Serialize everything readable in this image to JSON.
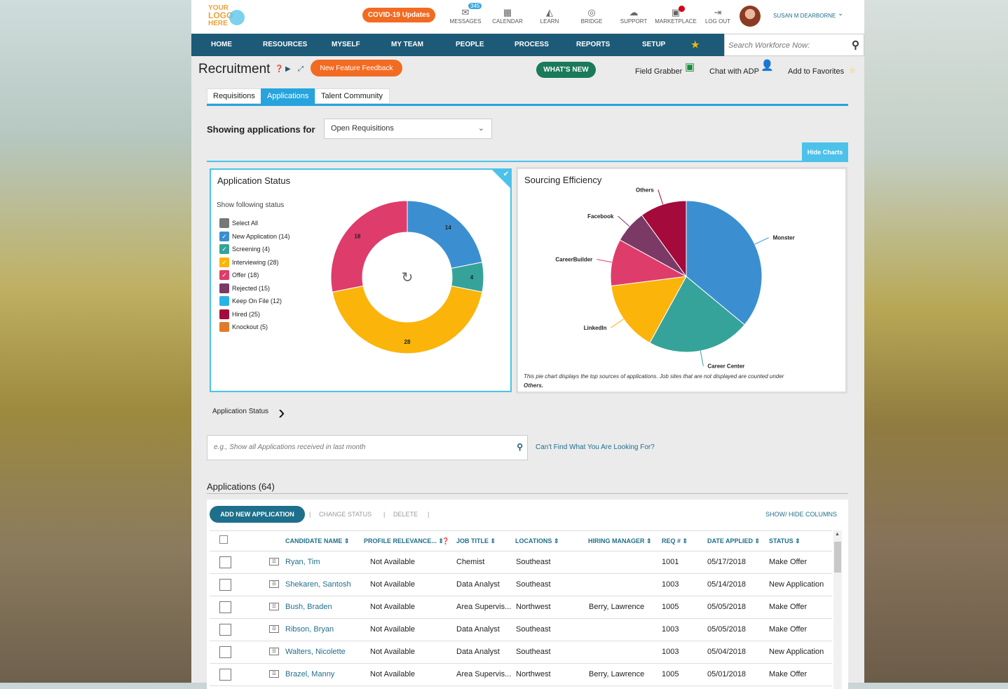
{
  "header": {
    "logo_line1": "YOUR",
    "logo_line2": "LOGO",
    "logo_line3": "HERE",
    "covid_label": "COVID-19 Updates",
    "messages_badge": "345",
    "tools": [
      {
        "label": "MESSAGES",
        "icon": "envelope-icon"
      },
      {
        "label": "CALENDAR",
        "icon": "calendar-icon"
      },
      {
        "label": "LEARN",
        "icon": "graduation-cap-icon"
      },
      {
        "label": "BRIDGE",
        "icon": "bridge-icon"
      },
      {
        "label": "SUPPORT",
        "icon": "speech-bubble-icon"
      },
      {
        "label": "MARKETPLACE",
        "icon": "store-icon"
      },
      {
        "label": "LOG OUT",
        "icon": "logout-icon"
      }
    ],
    "user_name": "SUSAN M DEARBORNE"
  },
  "nav": {
    "items": [
      "HOME",
      "RESOURCES",
      "MYSELF",
      "MY TEAM",
      "PEOPLE",
      "PROCESS",
      "REPORTS",
      "SETUP"
    ],
    "search_placeholder": "Search Workforce Now:"
  },
  "page": {
    "title": "Recruitment",
    "feedback_label": "New Feature Feedback",
    "whats_new_label": "WHAT'S NEW",
    "field_grabber": "Field Grabber",
    "chat_adp": "Chat with ADP",
    "favorites": "Add to Favorites"
  },
  "tabs": [
    "Requisitions",
    "Applications",
    "Talent Community"
  ],
  "filter": {
    "label": "Showing applications for",
    "value": "Open Requisitions"
  },
  "hide_charts": "Hide Charts",
  "status_chart": {
    "title": "Application Status",
    "show_label": "Show following status",
    "legend": [
      {
        "label": "Select All",
        "color": "#777777",
        "checked": false
      },
      {
        "label": "New Application (14)",
        "color": "#3b8fd1",
        "checked": true
      },
      {
        "label": "Screening (4)",
        "color": "#36a39a",
        "checked": true
      },
      {
        "label": "Interviewing (28)",
        "color": "#fbb40a",
        "checked": true
      },
      {
        "label": "Offer (18)",
        "color": "#de3c6b",
        "checked": true
      },
      {
        "label": "Rejected (15)",
        "color": "#7b3a66",
        "checked": false
      },
      {
        "label": "Keep On File (12)",
        "color": "#2ab4e6",
        "checked": false
      },
      {
        "label": "Hired (25)",
        "color": "#a40a3c",
        "checked": false
      },
      {
        "label": "Knockout (5)",
        "color": "#e07b2a",
        "checked": false
      }
    ]
  },
  "sourcing_chart": {
    "title": "Sourcing Efficiency",
    "note": "This pie chart displays the top sources of applications. Job sites that are not displayed are counted under",
    "note_bold": "Others."
  },
  "chart_data": [
    {
      "type": "pie",
      "title": "Application Status",
      "donut": true,
      "labels": [
        "New Application",
        "Screening",
        "Interviewing",
        "Offer"
      ],
      "values": [
        14,
        4,
        28,
        18
      ],
      "colors": [
        "#3b8fd1",
        "#36a39a",
        "#fbb40a",
        "#de3c6b"
      ]
    },
    {
      "type": "pie",
      "title": "Sourcing Efficiency",
      "labels": [
        "Monster",
        "Career Center",
        "LinkedIn",
        "CareerBuilder",
        "Facebook",
        "Others"
      ],
      "values": [
        36,
        22,
        15,
        10,
        7,
        10
      ],
      "colors": [
        "#3b8fd1",
        "#36a39a",
        "#fbb40a",
        "#de3c6b",
        "#7b3a66",
        "#a40a3c"
      ]
    }
  ],
  "app_status_toggle": "Application Status",
  "query": {
    "placeholder": "e.g., Show all Applications received in last month",
    "cant_find": "Can't Find What You Are Looking For?"
  },
  "applications": {
    "title": "Applications (64)",
    "add_label": "ADD NEW APPLICATION",
    "change_status": "CHANGE STATUS",
    "delete": "DELETE",
    "show_hide": "SHOW/ HIDE COLUMNS",
    "columns": [
      "CANDIDATE NAME",
      "PROFILE RELEVANCE...",
      "JOB TITLE",
      "LOCATIONS",
      "HIRING MANAGER",
      "REQ #",
      "DATE APPLIED",
      "STATUS"
    ],
    "rows": [
      {
        "name": "Ryan, Tim",
        "rel": "Not Available",
        "job": "Chemist",
        "loc": "Southeast",
        "mgr": "",
        "req": "1001",
        "date": "05/17/2018",
        "status": "Make Offer"
      },
      {
        "name": "Shekaren, Santosh",
        "rel": "Not Available",
        "job": "Data Analyst",
        "loc": "Southeast",
        "mgr": "",
        "req": "1003",
        "date": "05/14/2018",
        "status": "New Application"
      },
      {
        "name": "Bush, Braden",
        "rel": "Not Available",
        "job": "Area Supervis...",
        "loc": "Northwest",
        "mgr": "Berry, Lawrence",
        "req": "1005",
        "date": "05/05/2018",
        "status": "Make Offer"
      },
      {
        "name": "Ribson, Bryan",
        "rel": "Not Available",
        "job": "Data Analyst",
        "loc": "Southeast",
        "mgr": "",
        "req": "1003",
        "date": "05/05/2018",
        "status": "Make Offer"
      },
      {
        "name": "Walters, Nicolette",
        "rel": "Not Available",
        "job": "Data Analyst",
        "loc": "Southeast",
        "mgr": "",
        "req": "1003",
        "date": "05/04/2018",
        "status": "New Application"
      },
      {
        "name": "Brazel, Manny",
        "rel": "Not Available",
        "job": "Area Supervis...",
        "loc": "Northwest",
        "mgr": "Berry, Lawrence",
        "req": "1005",
        "date": "05/01/2018",
        "status": "Make Offer"
      }
    ]
  }
}
